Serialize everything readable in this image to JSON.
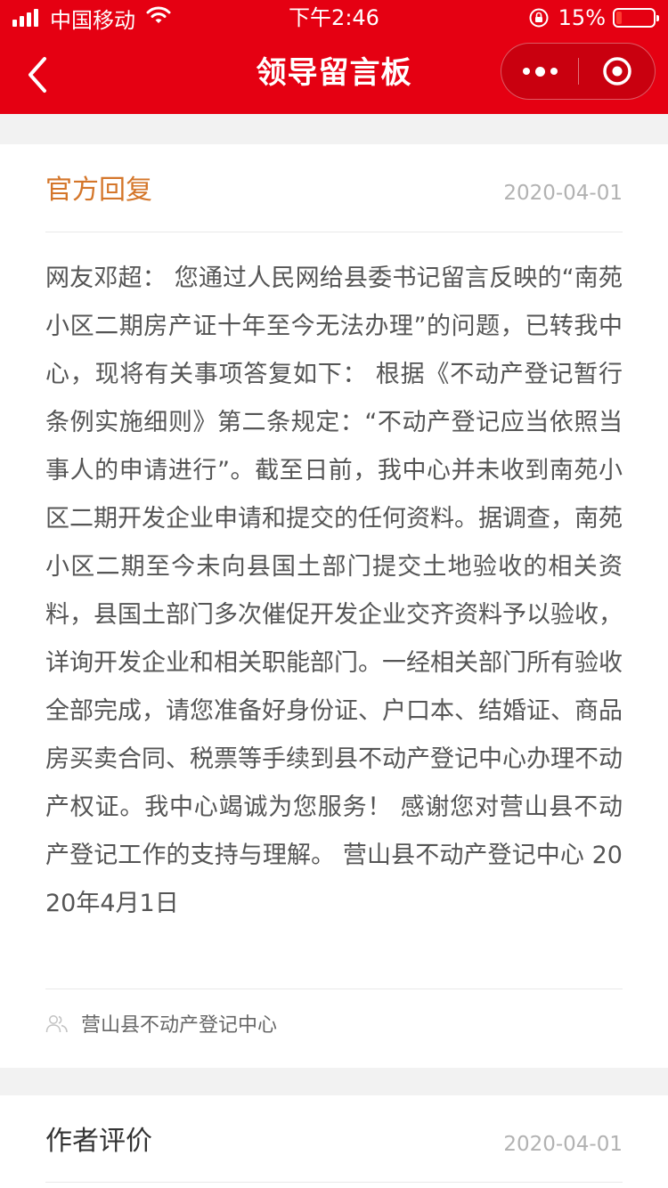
{
  "status_bar": {
    "carrier": "中国移动",
    "time": "下午2:46",
    "battery_percent": "15%",
    "battery_level": 0.15,
    "icons": [
      "signal-icon",
      "wifi-icon",
      "orientation-lock-icon",
      "battery-icon"
    ]
  },
  "nav": {
    "title": "领导留言板",
    "icons": [
      "back-icon",
      "more-icon",
      "close-icon"
    ]
  },
  "reply_card": {
    "title": "官方回复",
    "date": "2020-04-01",
    "body": "网友邓超： 您通过人民网给县委书记留言反映的“南苑小区二期房产证十年至今无法办理”的问题，已转我中心，现将有关事项答复如下： 根据《不动产登记暂行条例实施细则》第二条规定：“不动产登记应当依照当事人的申请进行”。截至日前，我中心并未收到南苑小区二期开发企业申请和提交的任何资料。据调查，南苑小区二期至今未向县国土部门提交土地验收的相关资料，县国土部门多次催促开发企业交齐资料予以验收，详询开发企业和相关职能部门。一经相关部门所有验收全部完成，请您准备好身份证、户口本、结婚证、商品房买卖合同、税票等手续到县不动产登记中心办理不动产权证。我中心竭诚为您服务！ 感谢您对营山县不动产登记工作的支持与理解。 营山县不动产登记中心 2020年4月1日",
    "responder": "营山县不动产登记中心"
  },
  "rating_card": {
    "title": "作者评价",
    "date": "2020-04-01"
  },
  "colors": {
    "header_red": "#e50012",
    "reply_title": "#d4762a",
    "page_bg": "#f2f2f2"
  }
}
